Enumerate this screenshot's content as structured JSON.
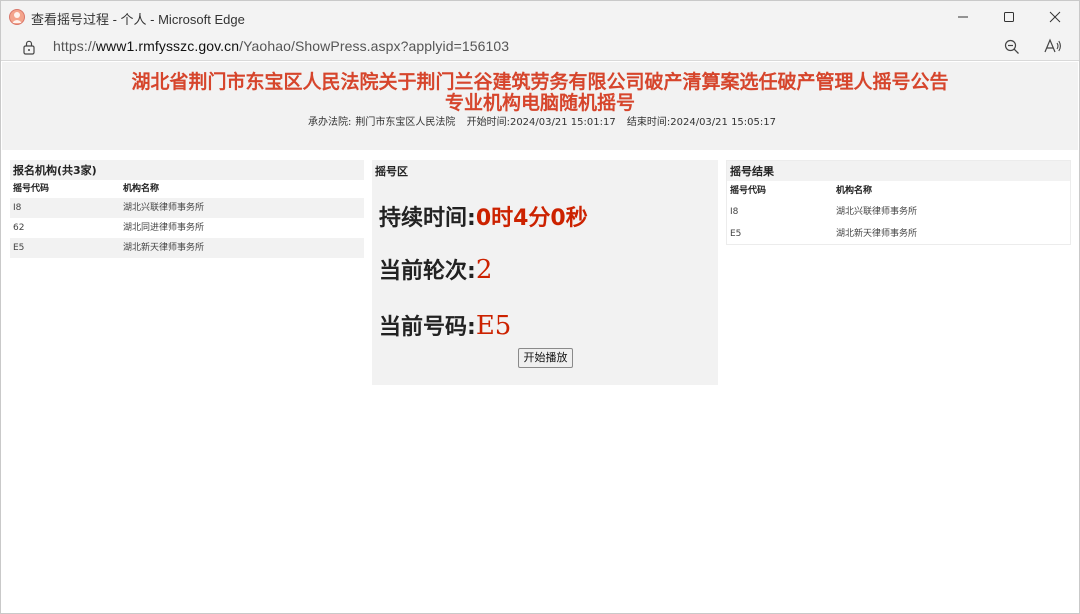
{
  "window": {
    "title": "查看摇号过程 - 个人 - Microsoft Edge",
    "url_prefix": "https://",
    "url_host": "www1.rmfysszc.gov.cn",
    "url_path": "/Yaohao/ShowPress.aspx?applyid=156103"
  },
  "header": {
    "title_line1": "湖北省荆门市东宝区人民法院关于荆门兰谷建筑劳务有限公司破产清算案选任破产管理人摇号公告",
    "title_line2": "专业机构电脑随机摇号",
    "court_label": "承办法院:",
    "court_value": "荆门市东宝区人民法院",
    "start_label": "开始时间:",
    "start_value": "2024/03/21 15:01:17",
    "end_label": "结束时间:",
    "end_value": "2024/03/21 15:05:17"
  },
  "registered": {
    "title": "报名机构(共3家)",
    "col_code": "摇号代码",
    "col_name": "机构名称",
    "rows": [
      {
        "code": "I8",
        "name": "湖北兴联律师事务所"
      },
      {
        "code": "62",
        "name": "湖北同进律师事务所"
      },
      {
        "code": "E5",
        "name": "湖北新天律师事务所"
      }
    ]
  },
  "draw": {
    "title": "摇号区",
    "duration_label": "持续时间:",
    "duration_value": "0时4分0秒",
    "round_label": "当前轮次:",
    "round_value": "2",
    "number_label": "当前号码:",
    "number_value": "E5",
    "play_button": "开始播放"
  },
  "results": {
    "title": "摇号结果",
    "col_code": "摇号代码",
    "col_name": "机构名称",
    "rows": [
      {
        "code": "I8",
        "name": "湖北兴联律师事务所"
      },
      {
        "code": "E5",
        "name": "湖北新天律师事务所"
      }
    ]
  },
  "colors": {
    "accent_red": "#d6452c",
    "value_red": "#cc2200"
  }
}
